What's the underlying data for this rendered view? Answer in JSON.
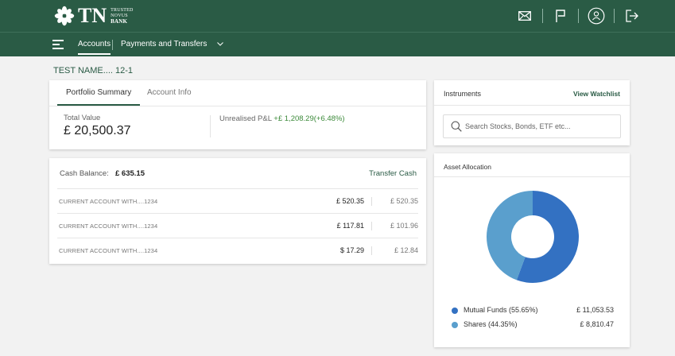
{
  "brand": {
    "logo_text": "TN",
    "sub_line1": "TRUSTED",
    "sub_line2": "NOVUS",
    "sub_line3": "BANK"
  },
  "header_icons": [
    "mail-icon",
    "flag-icon",
    "user-profile-icon",
    "logout-icon"
  ],
  "nav": {
    "menu_icon": "hamburger-icon",
    "accounts_label": "Accounts",
    "payments_label": "Payments and Transfers",
    "chevron": "chevron-down-icon"
  },
  "customer_name": "TEST NAME.... 12-1",
  "portfolio": {
    "tab_summary": "Portfolio Summary",
    "tab_info": "Account Info",
    "total_value_label": "Total Value",
    "total_value": "£ 20,500.37",
    "pnl_label": "Unrealised P&L",
    "pnl_value": "+£ 1,208.29(+6.48%)"
  },
  "cash": {
    "label": "Cash Balance:",
    "value": "£ 635.15",
    "transfer_label": "Transfer Cash",
    "accounts": [
      {
        "name": "CURRENT ACCOUNT WITH....1234",
        "balance": "£ 520.35",
        "available": "£ 520.35"
      },
      {
        "name": "CURRENT ACCOUNT WITH....1234",
        "balance": "£ 117.81",
        "available": "£ 101.96"
      },
      {
        "name": "CURRENT ACCOUNT WITH....1234",
        "balance": "$ 17.29",
        "available": "£ 12.84"
      }
    ]
  },
  "instruments": {
    "title": "Instruments",
    "watchlist_label": "View Watchlist",
    "search_placeholder": "Search Stocks, Bonds, ETF etc..."
  },
  "allocation": {
    "title": "Asset Allocation",
    "items": [
      {
        "label": "Mutual Funds (55.65%)",
        "value": "£ 11,053.53",
        "percent": 55.65,
        "color": "#3371c2"
      },
      {
        "label": "Shares (44.35%)",
        "value": "£ 8,810.47",
        "percent": 44.35,
        "color": "#5a9fcd"
      }
    ]
  },
  "colors": {
    "brand_green": "#2a5b45",
    "positive": "#3c8a3a"
  }
}
